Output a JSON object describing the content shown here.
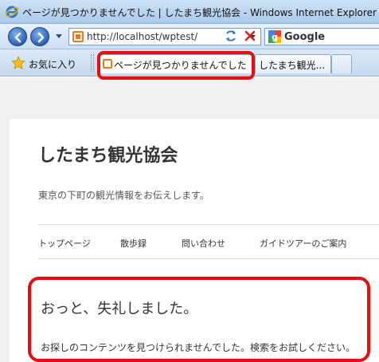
{
  "window": {
    "title": "ページが見つかりませんでした | したまち観光協会 - Windows Internet Explorer"
  },
  "navbar": {
    "address_url": "http://localhost/wptest/",
    "search_provider": "Google",
    "icons": [
      "back-icon",
      "forward-icon",
      "refresh-icon",
      "stop-icon",
      "google-icon"
    ]
  },
  "tabs": {
    "favorites_label": "お気に入り",
    "items": [
      {
        "label": "ページが見つかりませんでした",
        "active": true
      },
      {
        "label": "したまち観光...",
        "active": false
      }
    ]
  },
  "page": {
    "site_title": "したまち観光協会",
    "site_description": "東京の下町の観光情報をお伝えします。",
    "menu": [
      "トップページ",
      "散歩録",
      "問い合わせ",
      "ガイドツアーのご案内"
    ],
    "error_heading": "おっと、失礼しました。",
    "error_message": "お探しのコンテンツを見つけられませんでした。検索をお試しください。"
  },
  "colors": {
    "highlight": "#ea0d0d",
    "chrome_blue": "#2d63b8",
    "favicon_orange": "#e67a1c"
  }
}
